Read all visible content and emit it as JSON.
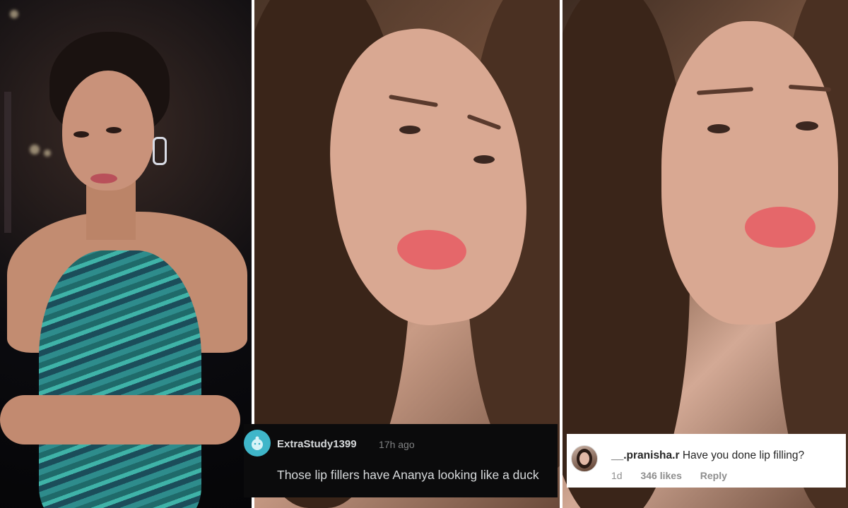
{
  "reddit_comment": {
    "username": "ExtraStudy1399",
    "separator": "·",
    "time": "17h ago",
    "text": "Those lip fillers have Ananya looking like a duck",
    "avatar_icon": "reddit-snoo-icon",
    "avatar_color": "#3fb6c9"
  },
  "instagram_comment": {
    "username": "__.pranisha.r",
    "text": "Have you done lip filling?",
    "age": "1d",
    "likes": "346 likes",
    "reply_label": "Reply"
  }
}
